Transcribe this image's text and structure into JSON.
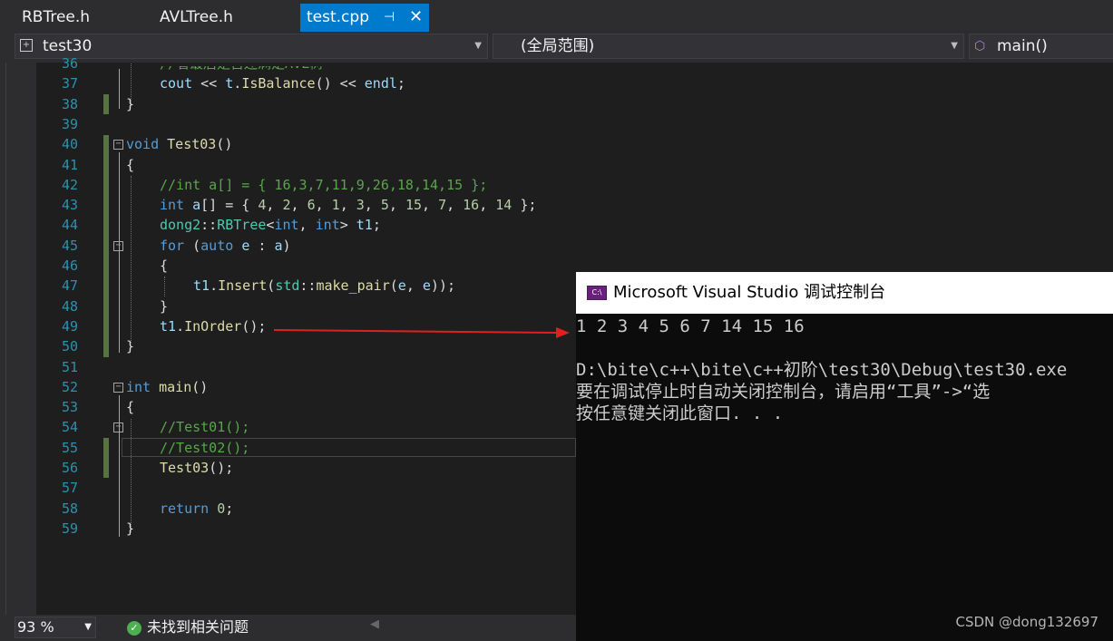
{
  "tabs": [
    {
      "label": "RBTree.h",
      "active": false
    },
    {
      "label": "AVLTree.h",
      "active": false
    },
    {
      "label": "test.cpp",
      "active": true
    }
  ],
  "navbar": {
    "project": "test30",
    "scope": "(全局范围)",
    "member": "main()"
  },
  "code_lines": [
    {
      "num": "36",
      "text": "//看最后是否还满足AVL树"
    },
    {
      "num": "37",
      "text": "cout << t.IsBalance() << endl;"
    },
    {
      "num": "38",
      "text": "}"
    },
    {
      "num": "39",
      "text": ""
    },
    {
      "num": "40",
      "text": "void Test03()"
    },
    {
      "num": "41",
      "text": "{"
    },
    {
      "num": "42",
      "text": "//int a[] = { 16,3,7,11,9,26,18,14,15 };"
    },
    {
      "num": "43",
      "text": "int a[] = { 4, 2, 6, 1, 3, 5, 15, 7, 16, 14 };"
    },
    {
      "num": "44",
      "text": "dong2::RBTree<int, int> t1;"
    },
    {
      "num": "45",
      "text": "for (auto e : a)"
    },
    {
      "num": "46",
      "text": "{"
    },
    {
      "num": "47",
      "text": "t1.Insert(std::make_pair(e, e));"
    },
    {
      "num": "48",
      "text": "}"
    },
    {
      "num": "49",
      "text": "t1.InOrder();"
    },
    {
      "num": "50",
      "text": "}"
    },
    {
      "num": "51",
      "text": ""
    },
    {
      "num": "52",
      "text": "int main()"
    },
    {
      "num": "53",
      "text": "{"
    },
    {
      "num": "54",
      "text": "//Test01();"
    },
    {
      "num": "55",
      "text": "//Test02();"
    },
    {
      "num": "56",
      "text": "Test03();"
    },
    {
      "num": "57",
      "text": ""
    },
    {
      "num": "58",
      "text": "return 0;"
    },
    {
      "num": "59",
      "text": "}"
    }
  ],
  "statusbar": {
    "zoom": "93 %",
    "issues": "未找到相关问题"
  },
  "console": {
    "title": "Microsoft Visual Studio 调试控制台",
    "icon_text": "C:\\",
    "lines": [
      "1 2 3 4 5 6 7 14 15 16",
      "",
      "D:\\bite\\c++\\bite\\c++初阶\\test30\\Debug\\test30.exe",
      "要在调试停止时自动关闭控制台，请启用“工具”->“选",
      "按任意键关闭此窗口. . ."
    ]
  },
  "watermark": "CSDN @dong132697",
  "colors": {
    "accent": "#007acc",
    "arrow": "#e02020",
    "change_bar": "#57743e"
  }
}
